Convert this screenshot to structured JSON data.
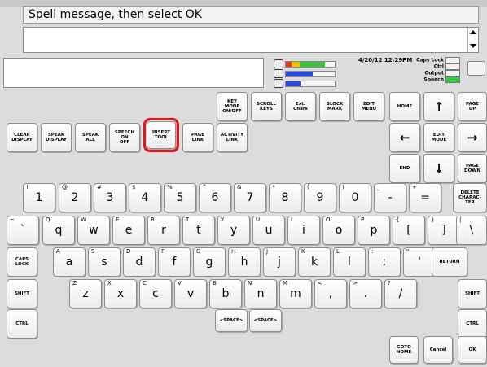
{
  "prompt": "Spell message, then select OK",
  "message_text": "",
  "datetime": "4/20/12 12:29PM",
  "indicators": [
    "Caps Lock",
    "Ctrl",
    "Output",
    "Speech"
  ],
  "colors": {
    "highlight": "#e0161d",
    "speech_on": "#2ecc40",
    "meter_red": "#e23b2a",
    "meter_yellow": "#f2c100",
    "meter_green": "#39c240",
    "meter_blue": "#2a49d8"
  },
  "meters": [
    {
      "name": "battery-icon",
      "level": 0.8
    },
    {
      "name": "speaker-icon",
      "level": 0.55
    },
    {
      "name": "headphones-icon",
      "level": 0.3
    }
  ],
  "keys": [
    {
      "l": "KEY\nMODE\nON/OFF",
      "t": "fn"
    },
    {
      "l": "SCROLL\nKEYS",
      "t": "fn"
    },
    {
      "l": "Ext.\nChars",
      "t": "fn"
    },
    {
      "l": "BLOCK\nMARK",
      "t": "fn"
    },
    {
      "l": "EDIT\nMENU",
      "t": "fn"
    },
    {
      "l": "HOME",
      "t": "fn"
    },
    {
      "l": "↑",
      "t": "arrow"
    },
    {
      "l": "PAGE\nUP",
      "t": "fn"
    },
    {
      "l": "CLEAR\nDISPLAY",
      "t": "fn"
    },
    {
      "l": "SPEAK\nDISPLAY",
      "t": "fn"
    },
    {
      "l": "SPEAK\nALL",
      "t": "fn"
    },
    {
      "l": "SPEECH\nON\nOFF",
      "t": "fn"
    },
    {
      "l": "INSERT\nTOOL",
      "t": "fn",
      "hl": true
    },
    {
      "l": "PAGE\nLINK",
      "t": "fn"
    },
    {
      "l": "ACTIVITY\nLINK",
      "t": "fn"
    },
    {
      "l": "←",
      "t": "arrow"
    },
    {
      "l": "EDIT\nMODE",
      "t": "fn"
    },
    {
      "l": "→",
      "t": "arrow"
    },
    {
      "l": "END",
      "t": "fn"
    },
    {
      "l": "↓",
      "t": "arrow"
    },
    {
      "l": "PAGE\nDOWN",
      "t": "fn"
    },
    {
      "l": "1",
      "s": "!",
      "t": "ch"
    },
    {
      "l": "2",
      "s": "@",
      "t": "ch"
    },
    {
      "l": "3",
      "s": "#",
      "t": "ch"
    },
    {
      "l": "4",
      "s": "$",
      "t": "ch"
    },
    {
      "l": "5",
      "s": "%",
      "t": "ch"
    },
    {
      "l": "6",
      "s": "^",
      "t": "ch"
    },
    {
      "l": "7",
      "s": "&",
      "t": "ch"
    },
    {
      "l": "8",
      "s": "*",
      "t": "ch"
    },
    {
      "l": "9",
      "s": "(",
      "t": "ch"
    },
    {
      "l": "0",
      "s": ")",
      "t": "ch"
    },
    {
      "l": "-",
      "s": "_",
      "t": "ch"
    },
    {
      "l": "=",
      "s": "+",
      "t": "ch"
    },
    {
      "l": "DELETE\nCHARAC-\nTER",
      "t": "fn"
    },
    {
      "l": "`",
      "s": "~",
      "t": "ch"
    },
    {
      "l": "q",
      "s": "Q",
      "t": "ch"
    },
    {
      "l": "w",
      "s": "W",
      "t": "ch"
    },
    {
      "l": "e",
      "s": "E",
      "t": "ch"
    },
    {
      "l": "r",
      "s": "R",
      "t": "ch"
    },
    {
      "l": "t",
      "s": "T",
      "t": "ch"
    },
    {
      "l": "y",
      "s": "Y",
      "t": "ch"
    },
    {
      "l": "u",
      "s": "U",
      "t": "ch"
    },
    {
      "l": "i",
      "s": "I",
      "t": "ch"
    },
    {
      "l": "o",
      "s": "O",
      "t": "ch"
    },
    {
      "l": "p",
      "s": "P",
      "t": "ch"
    },
    {
      "l": "[",
      "s": "{",
      "t": "ch"
    },
    {
      "l": "]",
      "s": "}",
      "t": "ch"
    },
    {
      "l": "\\",
      "s": "|",
      "t": "ch"
    },
    {
      "l": "CAPS\nLOCK",
      "t": "fn"
    },
    {
      "l": "a",
      "s": "A",
      "t": "ch"
    },
    {
      "l": "s",
      "s": "S",
      "t": "ch"
    },
    {
      "l": "d",
      "s": "D",
      "t": "ch"
    },
    {
      "l": "f",
      "s": "F",
      "t": "ch"
    },
    {
      "l": "g",
      "s": "G",
      "t": "ch"
    },
    {
      "l": "h",
      "s": "H",
      "t": "ch"
    },
    {
      "l": "j",
      "s": "J",
      "t": "ch"
    },
    {
      "l": "k",
      "s": "K",
      "t": "ch"
    },
    {
      "l": "l",
      "s": "L",
      "t": "ch"
    },
    {
      "l": ";",
      "s": ":",
      "t": "ch"
    },
    {
      "l": "'",
      "s": "\"",
      "t": "ch"
    },
    {
      "l": "RETURN",
      "t": "fn"
    },
    {
      "l": "SHIFT",
      "t": "fn"
    },
    {
      "l": "z",
      "s": "Z",
      "t": "ch"
    },
    {
      "l": "x",
      "s": "X",
      "t": "ch"
    },
    {
      "l": "c",
      "s": "C",
      "t": "ch"
    },
    {
      "l": "v",
      "s": "V",
      "t": "ch"
    },
    {
      "l": "b",
      "s": "B",
      "t": "ch"
    },
    {
      "l": "n",
      "s": "N",
      "t": "ch"
    },
    {
      "l": "m",
      "s": "M",
      "t": "ch"
    },
    {
      "l": ",",
      "s": "<",
      "t": "ch"
    },
    {
      "l": ".",
      "s": ">",
      "t": "ch"
    },
    {
      "l": "/",
      "s": "?",
      "t": "ch"
    },
    {
      "l": "SHIFT",
      "t": "fn"
    },
    {
      "l": "CTRL",
      "t": "fn"
    },
    {
      "l": "<SPACE>",
      "t": "fn"
    },
    {
      "l": "<SPACE>",
      "t": "fn"
    },
    {
      "l": "CTRL",
      "t": "fn"
    },
    {
      "l": "GOTO\nHOME",
      "t": "fn"
    },
    {
      "l": "Cancel",
      "t": "fn"
    },
    {
      "l": "OK",
      "t": "fn"
    }
  ]
}
